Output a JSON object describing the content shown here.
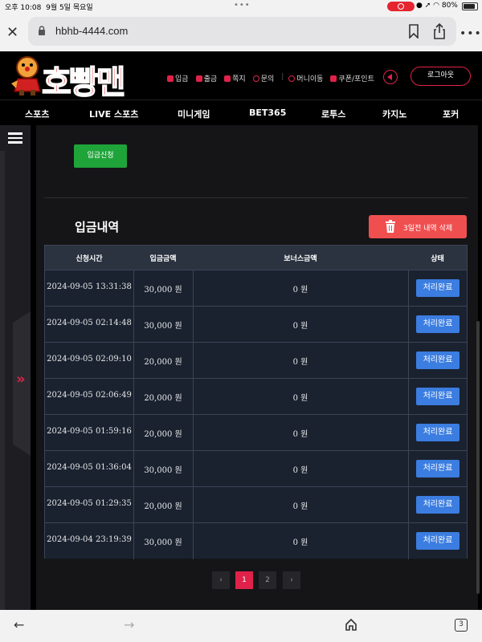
{
  "status_bar": {
    "time": "오후 10:08",
    "date": "9월 5일 목요일",
    "battery": "80%"
  },
  "browser": {
    "url": "hbhb-4444.com"
  },
  "site": {
    "logo": "호빵맨",
    "top_nav": [
      "입금",
      "출금",
      "쪽지",
      "문의",
      "머니이동",
      "쿠폰/포인트"
    ],
    "logout": "로그아웃",
    "main_nav": [
      "스포츠",
      "LIVE 스포츠",
      "미니게임",
      "BET365",
      "로투스",
      "카지노",
      "포커"
    ]
  },
  "deposit": {
    "apply_button": "입금신청",
    "section_title": "입금내역",
    "delete_button": "3일전 내역 삭제",
    "columns": [
      "신청시간",
      "입금금액",
      "보너스금액",
      "상태"
    ],
    "rows": [
      {
        "time": "2024-09-05 13:31:38",
        "amount": "30,000 원",
        "bonus": "0 원",
        "status": "처리완료"
      },
      {
        "time": "2024-09-05 02:14:48",
        "amount": "30,000 원",
        "bonus": "0 원",
        "status": "처리완료"
      },
      {
        "time": "2024-09-05 02:09:10",
        "amount": "20,000 원",
        "bonus": "0 원",
        "status": "처리완료"
      },
      {
        "time": "2024-09-05 02:06:49",
        "amount": "20,000 원",
        "bonus": "0 원",
        "status": "처리완료"
      },
      {
        "time": "2024-09-05 01:59:16",
        "amount": "20,000 원",
        "bonus": "0 원",
        "status": "처리완료"
      },
      {
        "time": "2024-09-05 01:36:04",
        "amount": "30,000 원",
        "bonus": "0 원",
        "status": "처리완료"
      },
      {
        "time": "2024-09-05 01:29:35",
        "amount": "20,000 원",
        "bonus": "0 원",
        "status": "처리완료"
      },
      {
        "time": "2024-09-04 23:19:39",
        "amount": "30,000 원",
        "bonus": "0 원",
        "status": "처리완료"
      }
    ],
    "pagination": {
      "prev": "‹",
      "pages": [
        "1",
        "2"
      ],
      "current": "1",
      "next": "›"
    }
  },
  "bottom_bar": {
    "tab_count": "3"
  },
  "colors": {
    "brand_red": "#e0224a",
    "apply_green": "#1fa43a",
    "delete_red": "#f04f50",
    "status_blue": "#3b7de0",
    "table_row": "#1a2230",
    "table_header": "#2c3340"
  },
  "icons": [
    "close-icon",
    "lock-icon",
    "bookmark-icon",
    "share-icon",
    "more-icon",
    "speaker-icon",
    "menu-icon",
    "chevron-right-icon",
    "trash-icon",
    "back-icon",
    "forward-icon",
    "home-icon",
    "tabs-icon"
  ]
}
